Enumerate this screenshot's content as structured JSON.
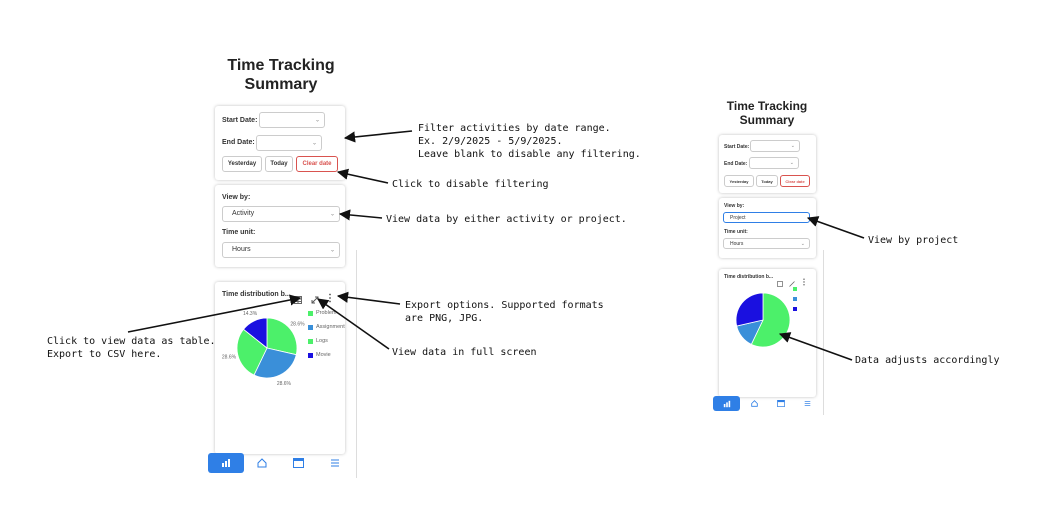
{
  "left": {
    "title_line1": "Time Tracking",
    "title_line2": "Summary",
    "start_date_label": "Start Date:",
    "end_date_label": "End Date:",
    "yesterday_btn": "Yesterday",
    "today_btn": "Today",
    "clear_btn": "Clear date",
    "view_by_label": "View by:",
    "view_by_value": "Activity",
    "time_unit_label": "Time unit:",
    "time_unit_value": "Hours",
    "chart_title": "Time distribution b..."
  },
  "right": {
    "title_line1": "Time Tracking",
    "title_line2": "Summary",
    "start_date_label": "Start Date:",
    "end_date_label": "End Date:",
    "yesterday_btn": "Yesterday",
    "today_btn": "Today",
    "clear_btn": "Clear date",
    "view_by_label": "View by:",
    "view_by_value": "Project",
    "time_unit_label": "Time unit:",
    "time_unit_value": "Hours",
    "chart_title": "Time distribution b..."
  },
  "notes": {
    "filter_line1": "Filter activities by date range.",
    "filter_line2": "Ex. 2/9/2025 - 5/9/2025.",
    "filter_line3": "Leave blank to disable any filtering.",
    "clear": "Click to disable filtering",
    "view": "View data by either activity or project.",
    "export_line1": "Export options. Supported formats",
    "export_line2": "are PNG, JPG.",
    "table_line1": "Click to view data as table.",
    "table_line2": "Export to CSV here.",
    "fullscreen": "View data in full screen",
    "view_project": "View by project",
    "adjusts": "Data adjusts accordingly"
  },
  "chart_data": [
    {
      "type": "pie",
      "categories": [
        "Problem",
        "Assignment",
        "Logs",
        "Movie"
      ],
      "legend_labels": [
        "Problem",
        "Assignment",
        "Logs",
        "Movie"
      ],
      "values": [
        28.6,
        28.6,
        28.6,
        14.3
      ],
      "value_labels": [
        "28.6%",
        "28.6%",
        "28.6%",
        "14.3%"
      ],
      "colors": [
        "#4cf06a",
        "#3a8fd9",
        "#4cf06a",
        "#1a10e0"
      ],
      "legend_colors": [
        "#4cf06a",
        "#3a8fd9",
        "#4cf06a",
        "#1a10e0"
      ],
      "legend_placement": "right"
    },
    {
      "type": "pie",
      "values": [
        57.1,
        14.3,
        28.6
      ],
      "colors": [
        "#4cf06a",
        "#3a8fd9",
        "#1a10e0"
      ],
      "legend_placement": "right"
    }
  ],
  "icons": {
    "table": "table-icon",
    "fullscreen": "expand-icon",
    "menu": "more-vertical-icon",
    "nav": [
      "chart-icon",
      "home-icon",
      "calendar-icon",
      "list-icon"
    ]
  },
  "colors": {
    "accent": "#2f7fe6",
    "clear": "#d9534f"
  }
}
